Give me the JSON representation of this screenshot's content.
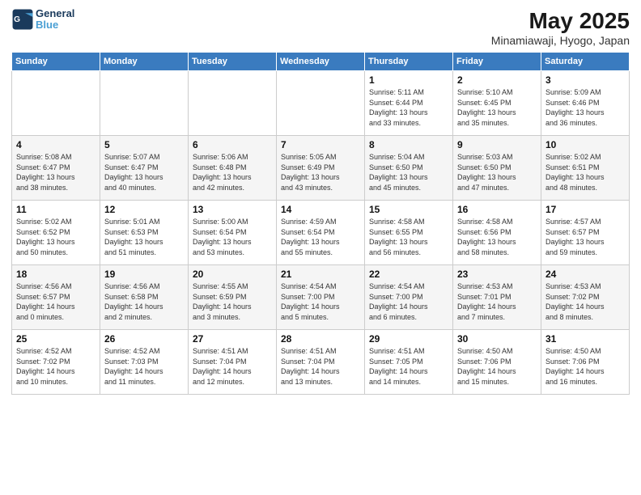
{
  "logo": {
    "text_general": "General",
    "text_blue": "Blue"
  },
  "header": {
    "month": "May 2025",
    "location": "Minamiawaji, Hyogo, Japan"
  },
  "weekdays": [
    "Sunday",
    "Monday",
    "Tuesday",
    "Wednesday",
    "Thursday",
    "Friday",
    "Saturday"
  ],
  "weeks": [
    [
      {
        "day": "",
        "info": ""
      },
      {
        "day": "",
        "info": ""
      },
      {
        "day": "",
        "info": ""
      },
      {
        "day": "",
        "info": ""
      },
      {
        "day": "1",
        "info": "Sunrise: 5:11 AM\nSunset: 6:44 PM\nDaylight: 13 hours\nand 33 minutes."
      },
      {
        "day": "2",
        "info": "Sunrise: 5:10 AM\nSunset: 6:45 PM\nDaylight: 13 hours\nand 35 minutes."
      },
      {
        "day": "3",
        "info": "Sunrise: 5:09 AM\nSunset: 6:46 PM\nDaylight: 13 hours\nand 36 minutes."
      }
    ],
    [
      {
        "day": "4",
        "info": "Sunrise: 5:08 AM\nSunset: 6:47 PM\nDaylight: 13 hours\nand 38 minutes."
      },
      {
        "day": "5",
        "info": "Sunrise: 5:07 AM\nSunset: 6:47 PM\nDaylight: 13 hours\nand 40 minutes."
      },
      {
        "day": "6",
        "info": "Sunrise: 5:06 AM\nSunset: 6:48 PM\nDaylight: 13 hours\nand 42 minutes."
      },
      {
        "day": "7",
        "info": "Sunrise: 5:05 AM\nSunset: 6:49 PM\nDaylight: 13 hours\nand 43 minutes."
      },
      {
        "day": "8",
        "info": "Sunrise: 5:04 AM\nSunset: 6:50 PM\nDaylight: 13 hours\nand 45 minutes."
      },
      {
        "day": "9",
        "info": "Sunrise: 5:03 AM\nSunset: 6:50 PM\nDaylight: 13 hours\nand 47 minutes."
      },
      {
        "day": "10",
        "info": "Sunrise: 5:02 AM\nSunset: 6:51 PM\nDaylight: 13 hours\nand 48 minutes."
      }
    ],
    [
      {
        "day": "11",
        "info": "Sunrise: 5:02 AM\nSunset: 6:52 PM\nDaylight: 13 hours\nand 50 minutes."
      },
      {
        "day": "12",
        "info": "Sunrise: 5:01 AM\nSunset: 6:53 PM\nDaylight: 13 hours\nand 51 minutes."
      },
      {
        "day": "13",
        "info": "Sunrise: 5:00 AM\nSunset: 6:54 PM\nDaylight: 13 hours\nand 53 minutes."
      },
      {
        "day": "14",
        "info": "Sunrise: 4:59 AM\nSunset: 6:54 PM\nDaylight: 13 hours\nand 55 minutes."
      },
      {
        "day": "15",
        "info": "Sunrise: 4:58 AM\nSunset: 6:55 PM\nDaylight: 13 hours\nand 56 minutes."
      },
      {
        "day": "16",
        "info": "Sunrise: 4:58 AM\nSunset: 6:56 PM\nDaylight: 13 hours\nand 58 minutes."
      },
      {
        "day": "17",
        "info": "Sunrise: 4:57 AM\nSunset: 6:57 PM\nDaylight: 13 hours\nand 59 minutes."
      }
    ],
    [
      {
        "day": "18",
        "info": "Sunrise: 4:56 AM\nSunset: 6:57 PM\nDaylight: 14 hours\nand 0 minutes."
      },
      {
        "day": "19",
        "info": "Sunrise: 4:56 AM\nSunset: 6:58 PM\nDaylight: 14 hours\nand 2 minutes."
      },
      {
        "day": "20",
        "info": "Sunrise: 4:55 AM\nSunset: 6:59 PM\nDaylight: 14 hours\nand 3 minutes."
      },
      {
        "day": "21",
        "info": "Sunrise: 4:54 AM\nSunset: 7:00 PM\nDaylight: 14 hours\nand 5 minutes."
      },
      {
        "day": "22",
        "info": "Sunrise: 4:54 AM\nSunset: 7:00 PM\nDaylight: 14 hours\nand 6 minutes."
      },
      {
        "day": "23",
        "info": "Sunrise: 4:53 AM\nSunset: 7:01 PM\nDaylight: 14 hours\nand 7 minutes."
      },
      {
        "day": "24",
        "info": "Sunrise: 4:53 AM\nSunset: 7:02 PM\nDaylight: 14 hours\nand 8 minutes."
      }
    ],
    [
      {
        "day": "25",
        "info": "Sunrise: 4:52 AM\nSunset: 7:02 PM\nDaylight: 14 hours\nand 10 minutes."
      },
      {
        "day": "26",
        "info": "Sunrise: 4:52 AM\nSunset: 7:03 PM\nDaylight: 14 hours\nand 11 minutes."
      },
      {
        "day": "27",
        "info": "Sunrise: 4:51 AM\nSunset: 7:04 PM\nDaylight: 14 hours\nand 12 minutes."
      },
      {
        "day": "28",
        "info": "Sunrise: 4:51 AM\nSunset: 7:04 PM\nDaylight: 14 hours\nand 13 minutes."
      },
      {
        "day": "29",
        "info": "Sunrise: 4:51 AM\nSunset: 7:05 PM\nDaylight: 14 hours\nand 14 minutes."
      },
      {
        "day": "30",
        "info": "Sunrise: 4:50 AM\nSunset: 7:06 PM\nDaylight: 14 hours\nand 15 minutes."
      },
      {
        "day": "31",
        "info": "Sunrise: 4:50 AM\nSunset: 7:06 PM\nDaylight: 14 hours\nand 16 minutes."
      }
    ]
  ]
}
